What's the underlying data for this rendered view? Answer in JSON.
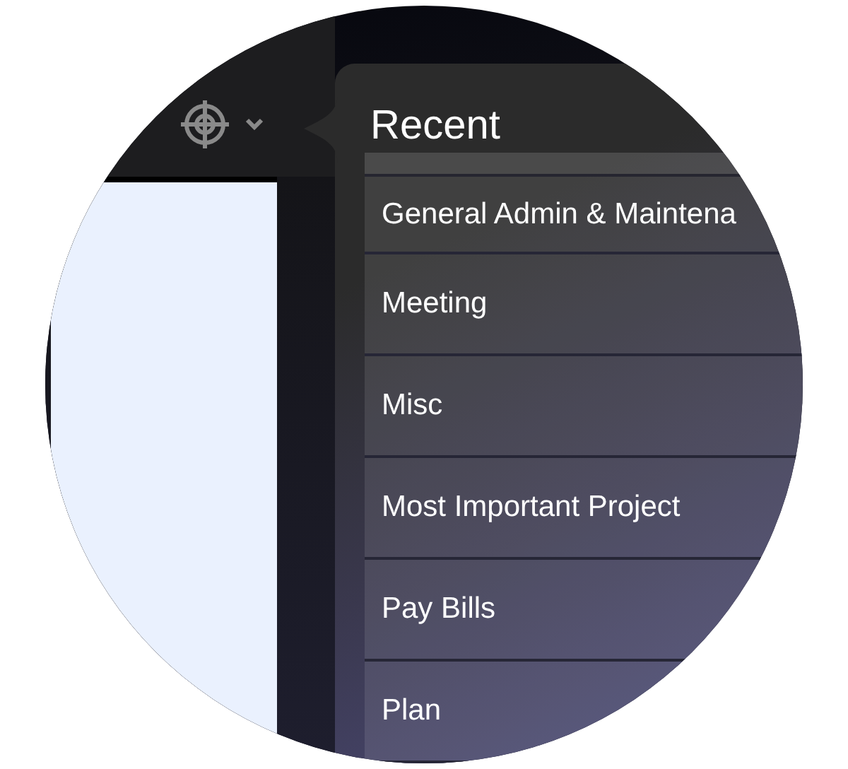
{
  "popover": {
    "title": "Recent",
    "items": [
      {
        "label": "General Admin & Maintena"
      },
      {
        "label": "Meeting"
      },
      {
        "label": "Misc"
      },
      {
        "label": "Most Important Project"
      },
      {
        "label": "Pay Bills"
      },
      {
        "label": "Plan"
      }
    ]
  }
}
